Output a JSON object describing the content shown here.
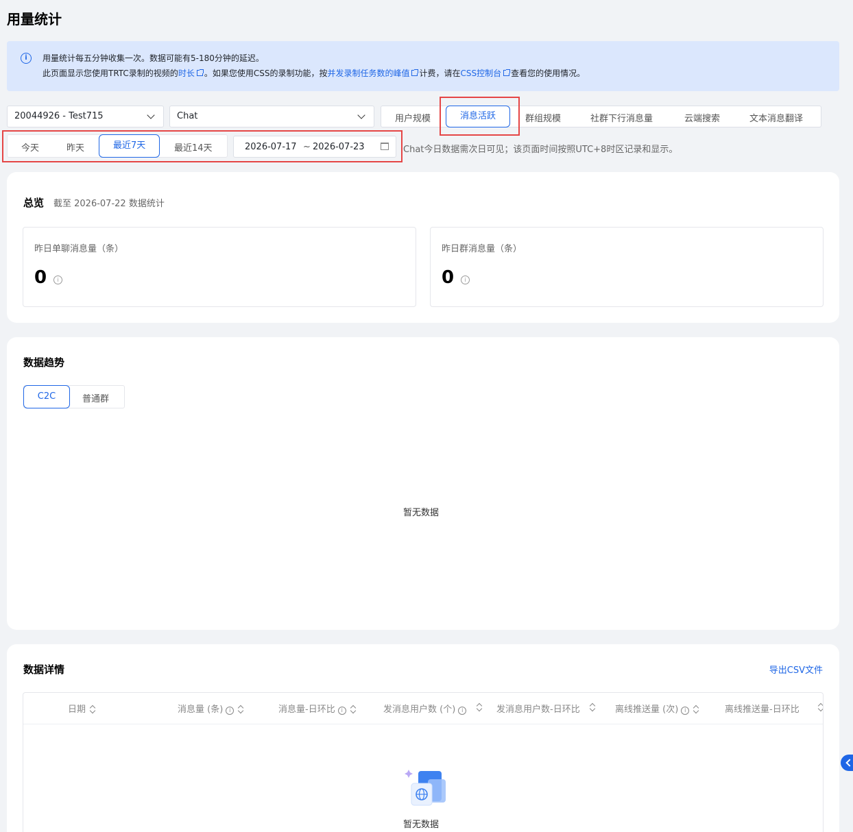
{
  "page": {
    "title": "用量统计"
  },
  "notice": {
    "line1": "用量统计每五分钟收集一次。数据可能有5-180分钟的延迟。",
    "line2_a": "此页面显示您使用TRTC录制的视频的",
    "line2_link1": "时长",
    "line2_b": "。如果您使用CSS的录制功能，按",
    "line2_link2": "并发录制任务数的峰值",
    "line2_c": "计费，请在",
    "line2_link3": "CSS控制台",
    "line2_d": "查看您的使用情况。"
  },
  "filters": {
    "app_select": "20044926 - Test715",
    "product_select": "Chat"
  },
  "metric_tabs": [
    "用户规模",
    "消息活跃",
    "群组规模",
    "社群下行消息量",
    "云端搜索",
    "文本消息翻译"
  ],
  "metric_tab_active": "消息活跃",
  "range": {
    "today": "今天",
    "yesterday": "昨天",
    "last7": "最近7天",
    "last14": "最近14天"
  },
  "date_picker": {
    "start": "2026-07-17",
    "sep": "~",
    "end": "2026-07-23"
  },
  "tz_note": "Chat今日数据需次日可见；该页面时间按照UTC+8时区记录和显示。",
  "overview": {
    "title": "总览",
    "subtitle": "截至 2026-07-22 数据统计",
    "stats": [
      {
        "label": "昨日单聊消息量（条）",
        "value": "0"
      },
      {
        "label": "昨日群消息量（条）",
        "value": "0"
      }
    ]
  },
  "trend": {
    "title": "数据趋势",
    "seg_c2c": "C2C",
    "seg_group": "普通群",
    "empty": "暂无数据"
  },
  "detail": {
    "title": "数据详情",
    "export": "导出CSV文件",
    "columns": [
      "日期",
      "消息量 (条)",
      "消息量-日环比",
      "发消息用户数 (个)",
      "发消息用户数-日环比",
      "离线推送量 (次)",
      "离线推送量-日环比"
    ],
    "empty": "暂无数据"
  }
}
